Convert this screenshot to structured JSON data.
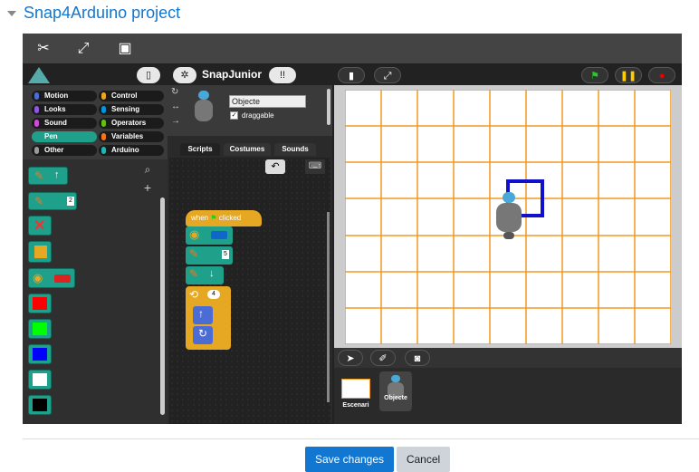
{
  "page": {
    "title": "Snap4Arduino project"
  },
  "toolbar": {
    "icons": [
      "tools-icon",
      "fullscreen-icon",
      "save-icon"
    ]
  },
  "snap": {
    "project_name": "SnapJunior",
    "categories": [
      {
        "label": "Motion",
        "color": "#4a6cd4"
      },
      {
        "label": "Looks",
        "color": "#8f56e3"
      },
      {
        "label": "Sound",
        "color": "#cf4ad9"
      },
      {
        "label": "Pen",
        "color": "#1fa08a"
      },
      {
        "label": "Other",
        "color": "#999999"
      },
      {
        "label": "Control",
        "color": "#e6a822"
      },
      {
        "label": "Sensing",
        "color": "#0494dc"
      },
      {
        "label": "Operators",
        "color": "#62c213"
      },
      {
        "label": "Variables",
        "color": "#f3761d"
      },
      {
        "label": "Arduino",
        "color": "#24b2b2"
      }
    ],
    "sprite": {
      "name": "Objecte",
      "draggable_label": "draggable",
      "draggable_checked": "✓"
    },
    "tabs": [
      "Scripts",
      "Costumes",
      "Sounds"
    ],
    "script": {
      "hat_prefix": "when",
      "hat_suffix": "clicked",
      "pen_size": "5",
      "repeat_count": "4"
    },
    "palette": {
      "pen_size_value": "2"
    },
    "corral": {
      "stage_label": "Escenari",
      "sprite_label": "Objecte"
    }
  },
  "actions": {
    "save_label": "Save changes",
    "cancel_label": "Cancel"
  }
}
